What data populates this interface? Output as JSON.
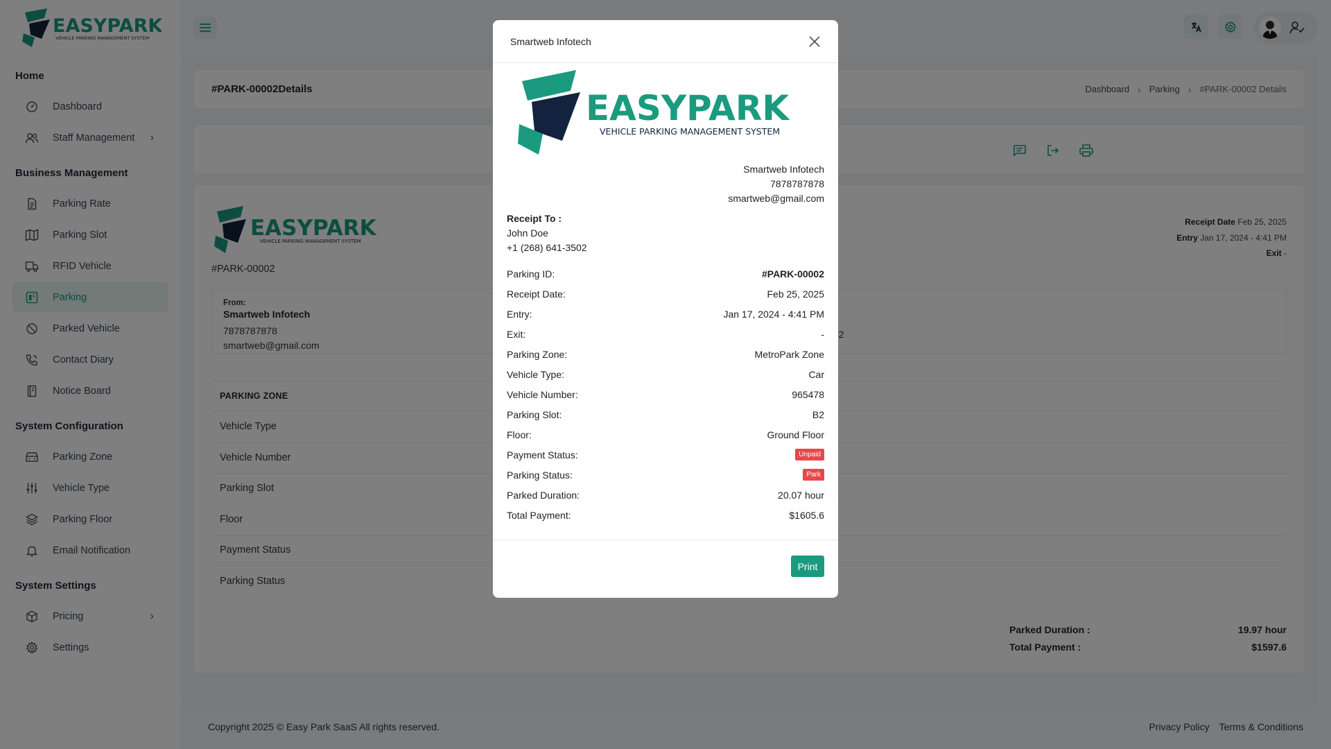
{
  "brand": {
    "name": "EASYPARK",
    "tagline": "VEHICLE PARKING MANAGEMENT SYSTEM",
    "accent": "#1a9b7f",
    "dark": "#13233f"
  },
  "sidebar": {
    "sections": [
      {
        "title": "Home",
        "items": [
          {
            "label": "Dashboard",
            "icon": "dashboard-icon"
          },
          {
            "label": "Staff Management",
            "icon": "users-icon",
            "chevron": true
          }
        ]
      },
      {
        "title": "Business Management",
        "items": [
          {
            "label": "Parking Rate",
            "icon": "document-icon"
          },
          {
            "label": "Parking Slot",
            "icon": "map-icon"
          },
          {
            "label": "RFID Vehicle",
            "icon": "truck-icon"
          },
          {
            "label": "Parking",
            "icon": "parking-icon",
            "active": true
          },
          {
            "label": "Parked Vehicle",
            "icon": "ban-icon"
          },
          {
            "label": "Contact Diary",
            "icon": "phone-icon"
          },
          {
            "label": "Notice Board",
            "icon": "notebook-icon"
          }
        ]
      },
      {
        "title": "System Configuration",
        "items": [
          {
            "label": "Parking Zone",
            "icon": "zone-icon"
          },
          {
            "label": "Vehicle Type",
            "icon": "sliders-icon"
          },
          {
            "label": "Parking Floor",
            "icon": "layers-icon"
          },
          {
            "label": "Email Notification",
            "icon": "bell-icon"
          }
        ]
      },
      {
        "title": "System Settings",
        "items": [
          {
            "label": "Pricing",
            "icon": "box-icon",
            "chevron": true
          },
          {
            "label": "Settings",
            "icon": "gear-icon"
          }
        ]
      }
    ]
  },
  "page": {
    "title": "#PARK-00002Details",
    "breadcrumb": [
      "Dashboard",
      "Parking",
      "#PARK-00002 Details"
    ]
  },
  "detail": {
    "id": "#PARK-00002",
    "meta": [
      {
        "label": "Receipt Date",
        "value": "Feb 25, 2025"
      },
      {
        "label": "Entry",
        "value": "Jan 17, 2024 - 4:41 PM"
      },
      {
        "label": "Exit",
        "value": "-"
      }
    ],
    "from_label": "From:",
    "from_name": "Smartweb Infotech",
    "from_phone": "7878787878",
    "from_email": "smartweb@gmail.com",
    "to_peek": "02",
    "table_head": "PARKING ZONE",
    "table_rows": [
      "Vehicle Type",
      "Vehicle Number",
      "Parking Slot",
      "Floor",
      "Payment Status",
      "Parking Status"
    ],
    "parked_duration_label": "Parked Duration :",
    "parked_duration": "19.97 hour",
    "total_payment_label": "Total Payment :",
    "total_payment": "$1597.6"
  },
  "footer": {
    "copyright": "Copyright 2025 © Easy Park SaaS All rights reserved.",
    "privacy": "Privacy Policy",
    "terms": "Terms & Conditions"
  },
  "modal": {
    "title": "Smartweb Infotech",
    "company": [
      "Smartweb Infotech",
      "7878787878",
      "smartweb@gmail.com"
    ],
    "receipt_to_label": "Receipt To :",
    "receipt_to_name": "John Doe",
    "receipt_to_phone": "+1 (268) 641-3502",
    "rows": [
      {
        "label": "Parking ID:",
        "value": "#PARK-00002",
        "bold": true
      },
      {
        "label": "Receipt Date:",
        "value": "Feb 25, 2025"
      },
      {
        "label": "Entry:",
        "value": "Jan 17, 2024 - 4:41 PM"
      },
      {
        "label": "Exit:",
        "value": "-"
      },
      {
        "label": "Parking Zone:",
        "value": "MetroPark Zone"
      },
      {
        "label": "Vehicle Type:",
        "value": "Car"
      },
      {
        "label": "Vehicle Number:",
        "value": "965478"
      },
      {
        "label": "Parking Slot:",
        "value": "B2"
      },
      {
        "label": "Floor:",
        "value": "Ground Floor"
      },
      {
        "label": "Payment Status:",
        "value": "Unpaid",
        "badge": true
      },
      {
        "label": "Parking Status:",
        "value": "Park",
        "badge": true
      },
      {
        "label": "Parked Duration:",
        "value": "20.07 hour"
      },
      {
        "label": "Total Payment:",
        "value": "$1605.6"
      }
    ],
    "print_label": "Print"
  }
}
